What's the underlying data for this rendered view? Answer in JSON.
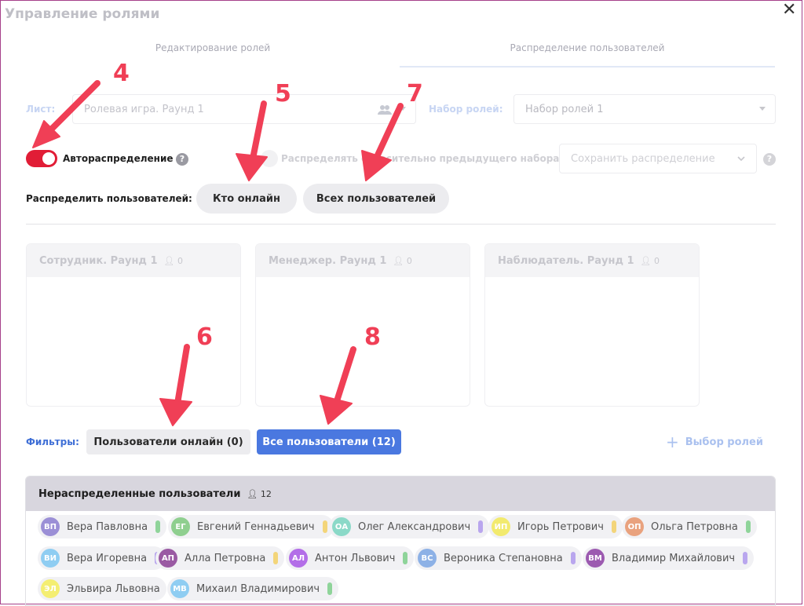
{
  "dialog": {
    "title": "Управление ролями",
    "close_glyph": "✕"
  },
  "tabs": [
    {
      "label": "Редактирование ролей"
    },
    {
      "label": "Распределение пользователей"
    }
  ],
  "sheet": {
    "label": "Лист:",
    "value": "Ролевая игра. Раунд 1"
  },
  "roleset": {
    "label": "Набор ролей:",
    "value": "Набор ролей 1"
  },
  "auto": {
    "label": "Автораспределение",
    "on": true
  },
  "relative": {
    "label": "Распределять относительно предыдущего набора"
  },
  "save": {
    "value": "Сохранить распределение"
  },
  "distribute": {
    "label": "Распределить пользователей:",
    "online_btn": "Кто онлайн",
    "all_btn": "Всех пользователей"
  },
  "roles": [
    {
      "name": "Сотрудник. Раунд 1",
      "count": "0"
    },
    {
      "name": "Менеджер. Раунд 1",
      "count": "0"
    },
    {
      "name": "Наблюдатель. Раунд 1",
      "count": "0"
    }
  ],
  "filters": {
    "label": "Фильтры:",
    "online": "Пользователи онлайн (0)",
    "all": "Все пользователи (12)",
    "choose_roles": "Выбор ролей"
  },
  "unassigned": {
    "title": "Нераспределенные пользователи",
    "count": "12",
    "users": [
      {
        "initials": "ВП",
        "name": "Вера Павловна",
        "avatar_color": "#9b8fd6",
        "bar_color": "#8fd49a"
      },
      {
        "initials": "ЕГ",
        "name": "Евгений Геннадьевич",
        "avatar_color": "#8fcf8f",
        "bar_color": "#f3d57a"
      },
      {
        "initials": "ОА",
        "name": "Олег Александрович",
        "avatar_color": "#8bd9c8",
        "bar_color": "#b9a6ee"
      },
      {
        "initials": "ИП",
        "name": "Игорь Петрович",
        "avatar_color": "#f2ea6e",
        "bar_color": "#f3d57a"
      },
      {
        "initials": "ОП",
        "name": "Ольга Петровна",
        "avatar_color": "#e9a27e",
        "bar_color": "#8fd49a"
      },
      {
        "initials": "ВИ",
        "name": "Вера Игоревна",
        "avatar_color": "#8fcdf2",
        "bar_color": "#b9a6ee"
      },
      {
        "initials": "АП",
        "name": "Алла Петровна",
        "avatar_color": "#9a5aa3",
        "bar_color": "#f3d57a"
      },
      {
        "initials": "АЛ",
        "name": "Антон Львович",
        "avatar_color": "#b36ee8",
        "bar_color": "#8fd49a"
      },
      {
        "initials": "ВС",
        "name": "Вероника Степановна",
        "avatar_color": "#8db1e6",
        "bar_color": "#b9a6ee"
      },
      {
        "initials": "ВМ",
        "name": "Владимир Михайлович",
        "avatar_color": "#9c5ab0",
        "bar_color": "#b9a6ee"
      },
      {
        "initials": "ЭЛ",
        "name": "Эльвира Львовна",
        "avatar_color": "#f4ee72",
        "bar_color": ""
      },
      {
        "initials": "МВ",
        "name": "Михаил Владимирович",
        "avatar_color": "#8fcdf2",
        "bar_color": "#8fd49a"
      }
    ]
  },
  "annotations": [
    "4",
    "5",
    "7",
    "6",
    "8"
  ],
  "colors": {
    "accent_blue": "#4a78e0",
    "toggle_red": "#e11d36",
    "annotation_red": "#f03f56"
  }
}
